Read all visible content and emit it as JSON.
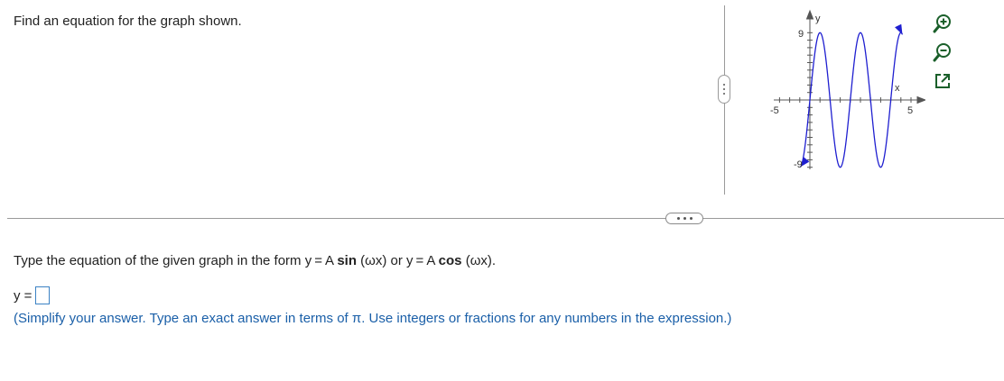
{
  "question": {
    "text": "Find an equation for the graph shown."
  },
  "graph": {
    "y_axis_label": "y",
    "x_axis_label": "x",
    "y_max_label": "9",
    "y_min_label": "-9",
    "x_min_label": "-5",
    "x_max_label": "5",
    "curve_color": "#1f1fd0",
    "axis_color": "#555555"
  },
  "tools": {
    "zoom_in": "zoom-in-icon",
    "zoom_out": "zoom-out-icon",
    "popout": "popout-icon"
  },
  "prompt": {
    "before": "Type the equation of the given graph in the form y = A ",
    "sin": "sin",
    "middle": " (ωx) or y = A ",
    "cos": "cos",
    "after": " (ωx)."
  },
  "answer": {
    "label": "y =",
    "value": ""
  },
  "hint": {
    "text": "(Simplify your answer. Type an exact answer in terms of π. Use integers or fractions for any numbers in the expression.)"
  }
}
